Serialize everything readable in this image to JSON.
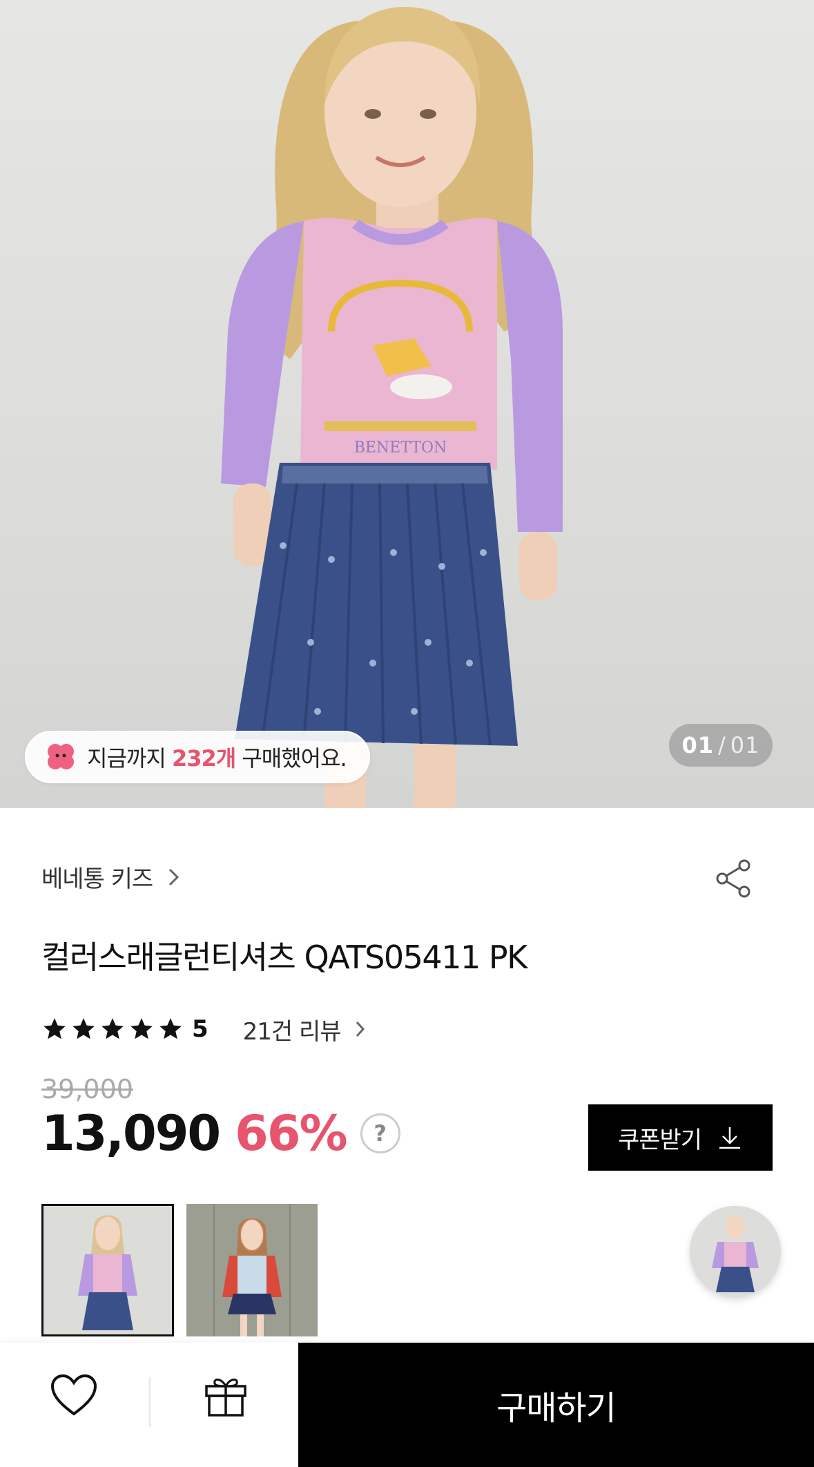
{
  "hero": {
    "purchase_prefix": "지금까지",
    "purchase_count": "232개",
    "purchase_suffix": "구매했어요.",
    "counter_current": "01",
    "counter_sep": "/",
    "counter_total": "01",
    "shirt_text_brand": "BENETTON"
  },
  "product": {
    "brand": "베네통 키즈",
    "title": "컬러스래글런티셔츠 QATS05411 PK",
    "rating": "5",
    "stars_filled": 5,
    "review_label": "21건 리뷰",
    "original_price": "39,000",
    "price": "13,090",
    "discount": "66%",
    "help_label": "?",
    "coupon_label": "쿠폰받기"
  },
  "thumbnails": [
    {
      "label": "thumbnail-pink-purple"
    },
    {
      "label": "thumbnail-red-blue"
    }
  ],
  "bottom": {
    "buy_label": "구매하기"
  },
  "colors": {
    "accent": "#e8536d",
    "black": "#000000"
  }
}
